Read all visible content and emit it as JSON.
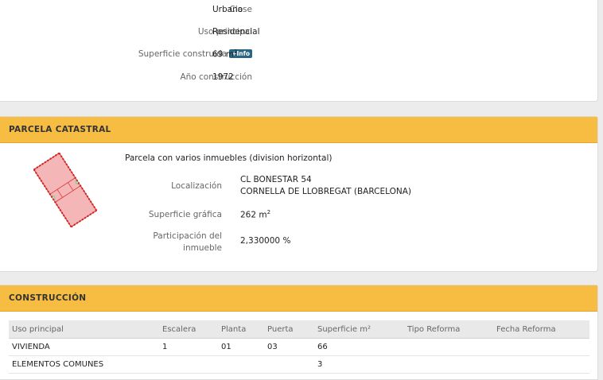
{
  "inmueble": {
    "clase_label": "Clase",
    "clase_value": "Urbano",
    "uso_label": "Uso principal",
    "uso_value": "Residencial",
    "superficie_label": "Superficie construida",
    "info_badge": "+Info",
    "superficie_value": "69 m",
    "superficie_unit_exp": "2",
    "anio_label": "Año construcción",
    "anio_value": "1972"
  },
  "parcela": {
    "title": "PARCELA CATASTRAL",
    "description": "Parcela con varios inmuebles (division horizontal)",
    "localizacion_label": "Localización",
    "localizacion_line1": "CL BONESTAR 54",
    "localizacion_line2": "CORNELLA DE LLOBREGAT (BARCELONA)",
    "superficie_label": "Superficie gráfica",
    "superficie_value": "262 m",
    "superficie_unit_exp": "2",
    "participacion_label_line1": "Participación del",
    "participacion_label_line2": "inmueble",
    "participacion_value": "2,330000 %"
  },
  "construccion": {
    "title": "CONSTRUCCIÓN",
    "columns": [
      "Uso principal",
      "Escalera",
      "Planta",
      "Puerta",
      "Superficie m²",
      "Tipo Reforma",
      "Fecha Reforma"
    ],
    "rows": [
      [
        "VIVIENDA",
        "1",
        "01",
        "03",
        "66",
        "",
        ""
      ],
      [
        "ELEMENTOS COMUNES",
        "",
        "",
        "",
        "3",
        "",
        ""
      ]
    ]
  },
  "colors": {
    "header_bg": "#f7bd43",
    "badge_bg": "#2b6584",
    "parcel_fill": "#f4b6b6",
    "parcel_stroke": "#d33"
  }
}
